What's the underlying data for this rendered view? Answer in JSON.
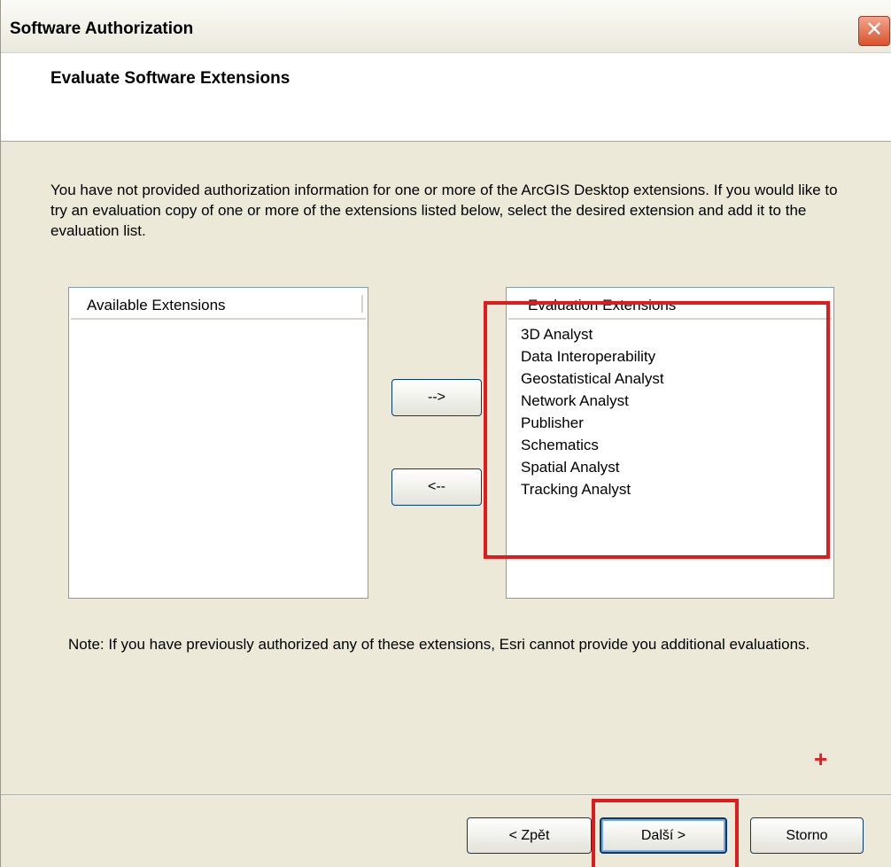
{
  "window": {
    "title": "Software Authorization",
    "close_icon": "close-icon"
  },
  "header": {
    "title": "Evaluate Software Extensions"
  },
  "intro": "You have not provided authorization information for one or more of the ArcGIS Desktop extensions.  If you would like to try an evaluation copy of one or more of the extensions listed below, select the desired extension and add it to the evaluation list.",
  "available": {
    "header": "Available Extensions",
    "items": []
  },
  "evaluation": {
    "header": "Evaluation Extensions",
    "items": [
      "3D Analyst",
      "Data Interoperability",
      "Geostatistical Analyst",
      "Network Analyst",
      "Publisher",
      "Schematics",
      "Spatial Analyst",
      "Tracking Analyst"
    ]
  },
  "transfer": {
    "add_label": "-->",
    "remove_label": "<--"
  },
  "note": "Note:  If you have previously authorized any of these extensions, Esri cannot provide you additional evaluations.",
  "annotation": {
    "plus": "+"
  },
  "footer": {
    "back_label": "< Zpět",
    "next_label": "Další >",
    "cancel_label": "Storno"
  },
  "colors": {
    "highlight": "#e31a1a",
    "dialog_bg": "#ece9d8"
  }
}
